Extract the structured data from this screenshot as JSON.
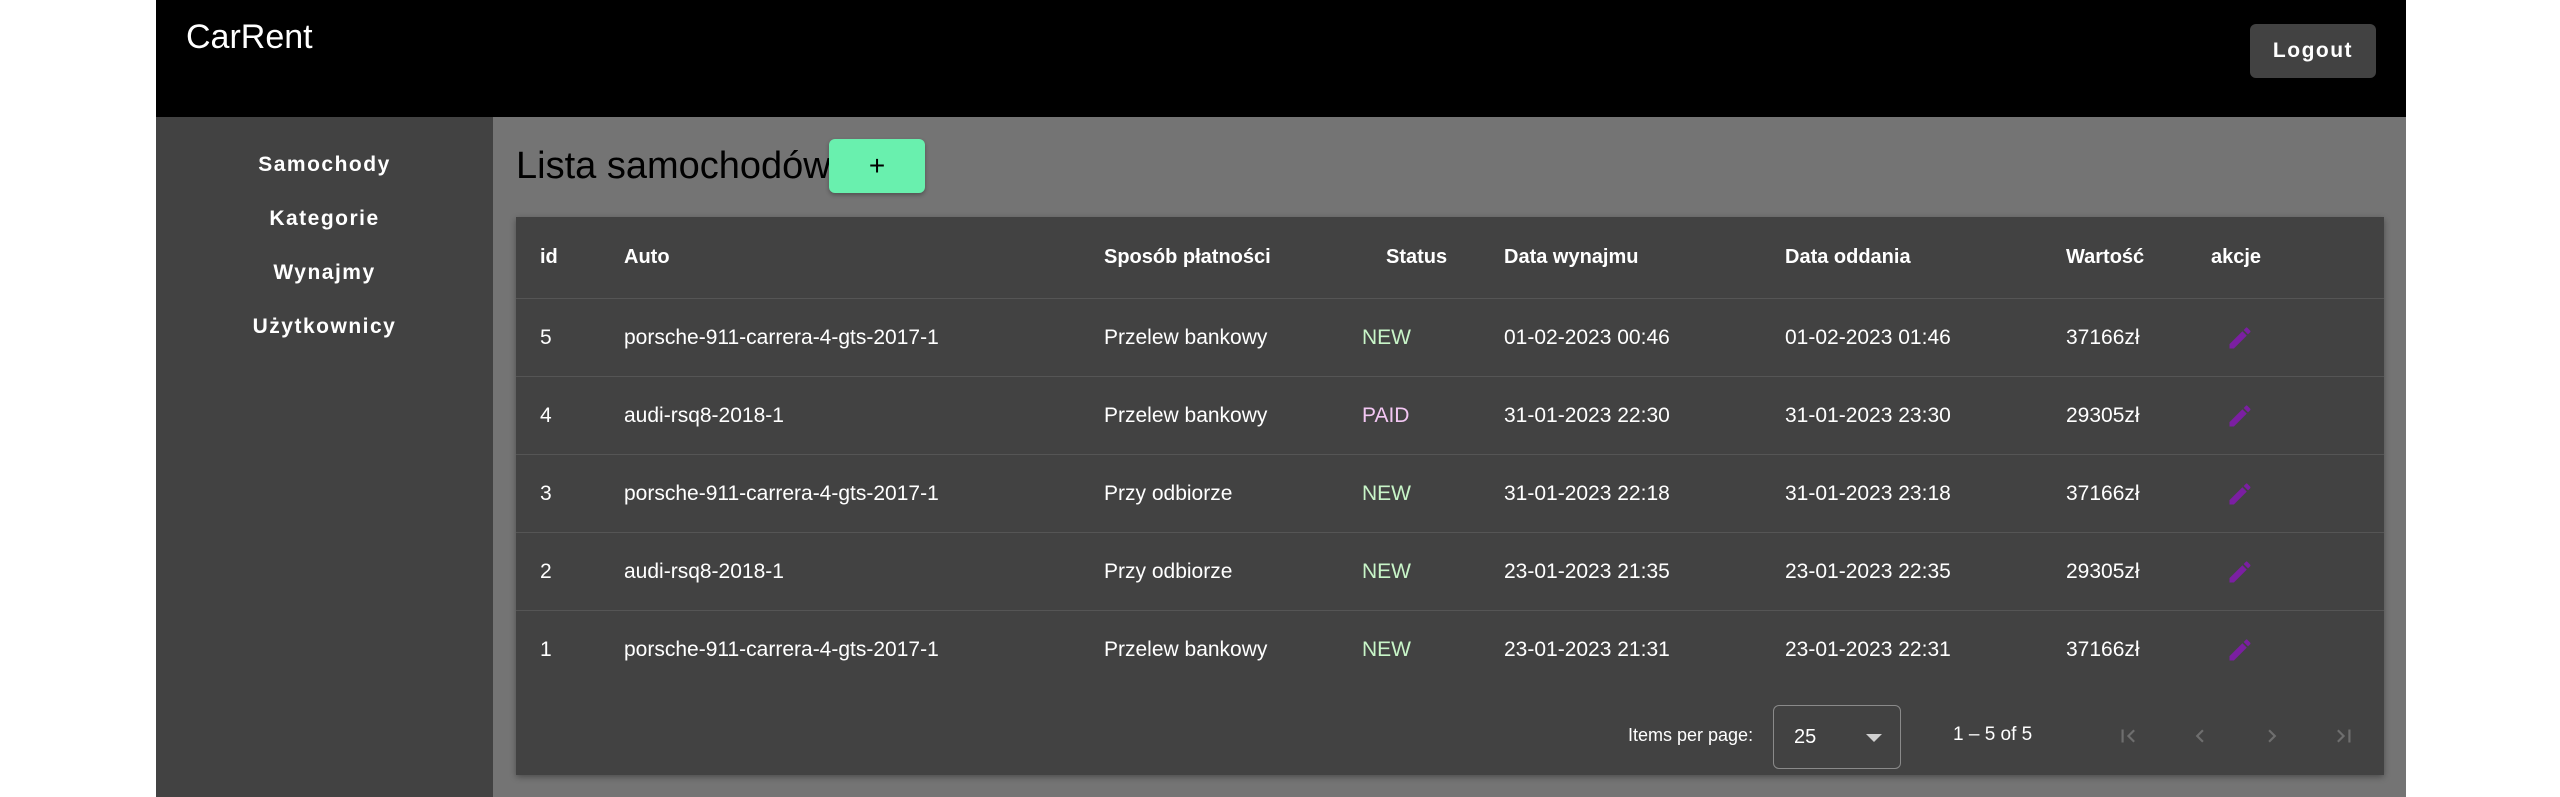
{
  "app": {
    "brand": "CarRent",
    "logout_label": "Logout"
  },
  "sidebar": {
    "items": [
      {
        "label": "Samochody"
      },
      {
        "label": "Kategorie"
      },
      {
        "label": "Wynajmy"
      },
      {
        "label": "Użytkownicy"
      }
    ]
  },
  "main": {
    "title": "Lista samochodów",
    "add_label": "+"
  },
  "table": {
    "columns": [
      "id",
      "Auto",
      "Sposób płatności",
      "Status",
      "Data wynajmu",
      "Data oddania",
      "Wartość",
      "akcje"
    ],
    "rows": [
      {
        "id": "5",
        "auto": "porsche-911-carrera-4-gts-2017-1",
        "payment": "Przelew bankowy",
        "status": "NEW",
        "rent_date": "01-02-2023 00:46",
        "return_date": "01-02-2023 01:46",
        "value": "37166zł",
        "action_icon": "pencil-icon"
      },
      {
        "id": "4",
        "auto": "audi-rsq8-2018-1",
        "payment": "Przelew bankowy",
        "status": "PAID",
        "rent_date": "31-01-2023 22:30",
        "return_date": "31-01-2023 23:30",
        "value": "29305zł",
        "action_icon": "pencil-icon"
      },
      {
        "id": "3",
        "auto": "porsche-911-carrera-4-gts-2017-1",
        "payment": "Przy odbiorze",
        "status": "NEW",
        "rent_date": "31-01-2023 22:18",
        "return_date": "31-01-2023 23:18",
        "value": "37166zł",
        "action_icon": "pencil-icon"
      },
      {
        "id": "2",
        "auto": "audi-rsq8-2018-1",
        "payment": "Przy odbiorze",
        "status": "NEW",
        "rent_date": "23-01-2023 21:35",
        "return_date": "23-01-2023 22:35",
        "value": "29305zł",
        "action_icon": "pencil-icon"
      },
      {
        "id": "1",
        "auto": "porsche-911-carrera-4-gts-2017-1",
        "payment": "Przelew bankowy",
        "status": "NEW",
        "rent_date": "23-01-2023 21:31",
        "return_date": "23-01-2023 22:31",
        "value": "37166zł",
        "action_icon": "pencil-icon"
      }
    ]
  },
  "paginator": {
    "items_per_page_label": "Items per page:",
    "page_size": "25",
    "range_label": "1 – 5 of 5"
  },
  "colors": {
    "topbar": "#000000",
    "sidebar": "#424242",
    "content_bg": "#747474",
    "card": "#424242",
    "add_button": "#69f0ae",
    "edit_icon": "#7b1fa2",
    "status_new": "#c8f5c8",
    "status_paid": "#f3c7f3"
  }
}
